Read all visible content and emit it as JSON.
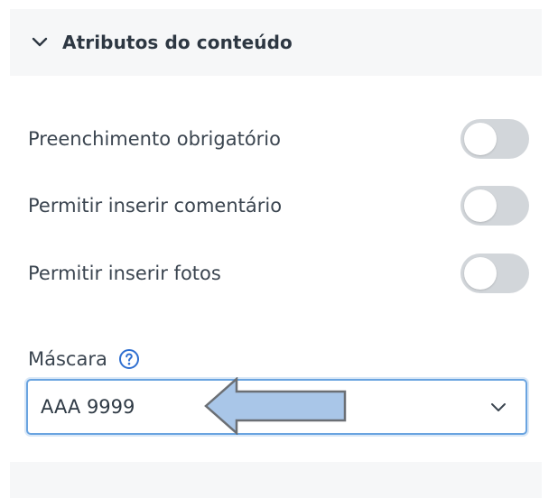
{
  "section": {
    "title": "Atributos do conteúdo",
    "expanded": true
  },
  "toggles": [
    {
      "label": "Preenchimento obrigatório",
      "on": false
    },
    {
      "label": "Permitir inserir comentário",
      "on": false
    },
    {
      "label": "Permitir inserir fotos",
      "on": false
    }
  ],
  "mask": {
    "label": "Máscara",
    "help_icon": "question-circle-icon",
    "selected_value": "AAA 9999",
    "dropdown_icon": "chevron-down-icon"
  },
  "colors": {
    "header_bg": "#f6f7f8",
    "toggle_off": "#d2d6da",
    "focus_border": "#6aa4e0",
    "help_blue": "#2f6fd0",
    "arrow_fill": "#a9c6e8"
  }
}
